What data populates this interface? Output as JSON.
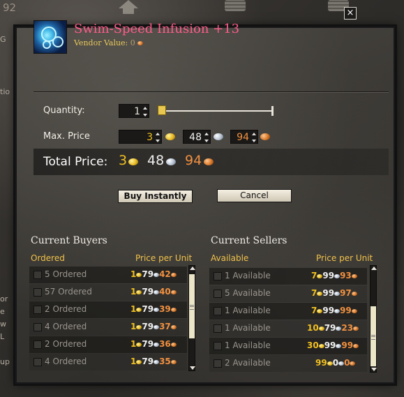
{
  "background": {
    "coin_count": "92",
    "edge_text": [
      "G",
      "tio",
      "or",
      "e",
      "w",
      "L",
      "up"
    ]
  },
  "item": {
    "name": "Swim-Speed Infusion +13",
    "vendor_label": "Vendor Value:",
    "vendor_value": "0",
    "icon": "infusion-bubbles-icon"
  },
  "close_label": "×",
  "quantity": {
    "label": "Quantity:",
    "value": "1",
    "slider_fraction": 0.0
  },
  "max_price": {
    "label": "Max. Price",
    "gold": "3",
    "silver": "48",
    "copper": "94"
  },
  "total_price": {
    "label": "Total Price:",
    "gold": "3",
    "silver": "48",
    "copper": "94"
  },
  "buttons": {
    "buy": "Buy Instantly",
    "cancel": "Cancel"
  },
  "buyers": {
    "title": "Current Buyers",
    "col_left": "Ordered",
    "col_right": "Price per Unit",
    "rows": [
      {
        "qty": "5 Ordered",
        "gold": "1",
        "silver": "79",
        "copper": "42"
      },
      {
        "qty": "57 Ordered",
        "gold": "1",
        "silver": "79",
        "copper": "40"
      },
      {
        "qty": "2 Ordered",
        "gold": "1",
        "silver": "79",
        "copper": "39"
      },
      {
        "qty": "4 Ordered",
        "gold": "1",
        "silver": "79",
        "copper": "37"
      },
      {
        "qty": "2 Ordered",
        "gold": "1",
        "silver": "79",
        "copper": "36"
      },
      {
        "qty": "4 Ordered",
        "gold": "1",
        "silver": "79",
        "copper": "35"
      }
    ]
  },
  "sellers": {
    "title": "Current Sellers",
    "col_left": "Available",
    "col_right": "Price per Unit",
    "rows": [
      {
        "qty": "1 Available",
        "gold": "7",
        "silver": "99",
        "copper": "93"
      },
      {
        "qty": "5 Available",
        "gold": "7",
        "silver": "99",
        "copper": "97"
      },
      {
        "qty": "1 Available",
        "gold": "7",
        "silver": "99",
        "copper": "99"
      },
      {
        "qty": "1 Available",
        "gold": "10",
        "silver": "79",
        "copper": "23"
      },
      {
        "qty": "1 Available",
        "gold": "30",
        "silver": "99",
        "copper": "99"
      },
      {
        "qty": "2 Available",
        "gold": "99",
        "silver": "0",
        "copper": "0"
      }
    ]
  },
  "colors": {
    "item_name": "#ff5c8a",
    "gold": "#f0c020",
    "silver": "#f0f0f0",
    "copper": "#f09040",
    "header": "#f0c24a"
  }
}
